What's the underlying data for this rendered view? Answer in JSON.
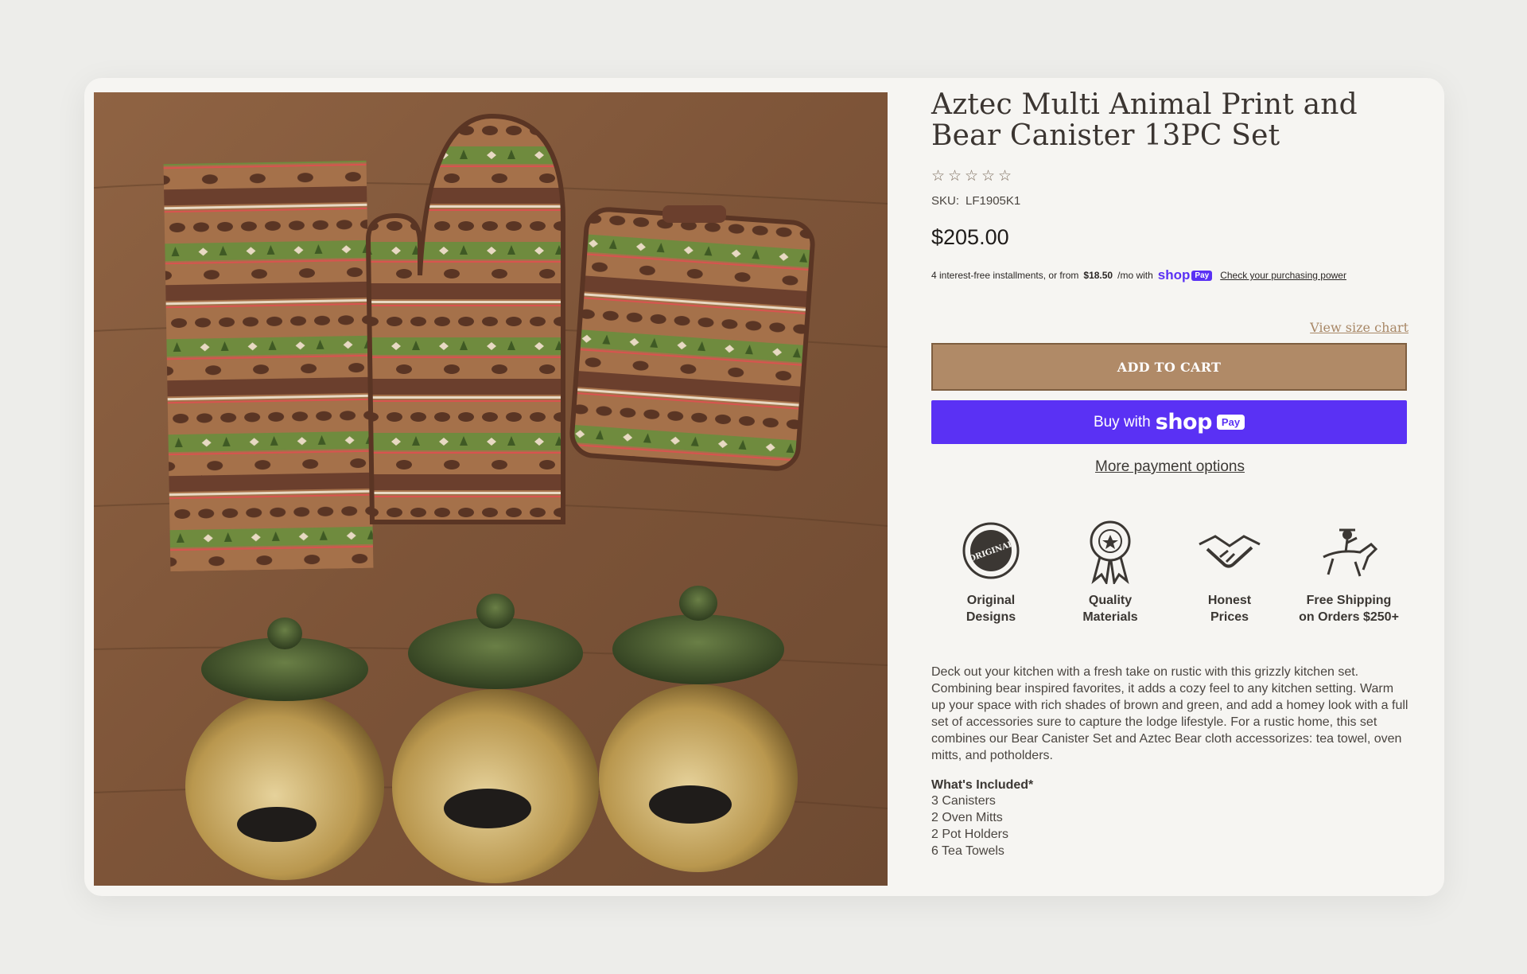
{
  "product": {
    "title": "Aztec Multi Animal Print and Bear Canister 13PC Set",
    "rating_stars": 0,
    "rating_max": 5,
    "sku_label": "SKU:",
    "sku_value": "LF1905K1",
    "price": "$205.00"
  },
  "installments": {
    "prefix": "4 interest-free installments, or from",
    "amount": "$18.50",
    "suffix": "/mo with",
    "shop_word": "shop",
    "pay_word": "Pay",
    "link": "Check your purchasing power"
  },
  "actions": {
    "size_chart": "View size chart",
    "add_to_cart": "ADD TO CART",
    "buy_prefix": "Buy with",
    "buy_brand": "shop",
    "buy_badge": "Pay",
    "more_options": "More payment options"
  },
  "features": [
    {
      "line1": "Original",
      "line2": "Designs",
      "icon": "original-seal-icon",
      "seal_text": "ORIGINAL"
    },
    {
      "line1": "Quality",
      "line2": "Materials",
      "icon": "award-ribbon-icon"
    },
    {
      "line1": "Honest",
      "line2": "Prices",
      "icon": "handshake-icon"
    },
    {
      "line1": "Free Shipping",
      "line2": "on Orders $250+",
      "icon": "pony-express-rider-icon"
    }
  ],
  "description": "Deck out your kitchen with a fresh take on rustic with this grizzly kitchen set. Combining bear inspired favorites, it adds a cozy feel to any kitchen setting. Warm up your space with rich shades of brown and green, and add a homey look with a full set of accessories sure to capture the lodge lifestyle. For a rustic home, this set combines our Bear Canister Set and Aztec Bear cloth accessorizes: tea towel, oven mitts, and potholders.",
  "included": {
    "title": "What's Included*",
    "items": [
      "3 Canisters",
      "2 Oven Mitts",
      "2 Pot Holders",
      "6 Tea Towels"
    ]
  },
  "colors": {
    "accent": "#b08a67",
    "shop_pay": "#5a31f4",
    "background": "#ededea",
    "card": "#f6f5f2"
  }
}
